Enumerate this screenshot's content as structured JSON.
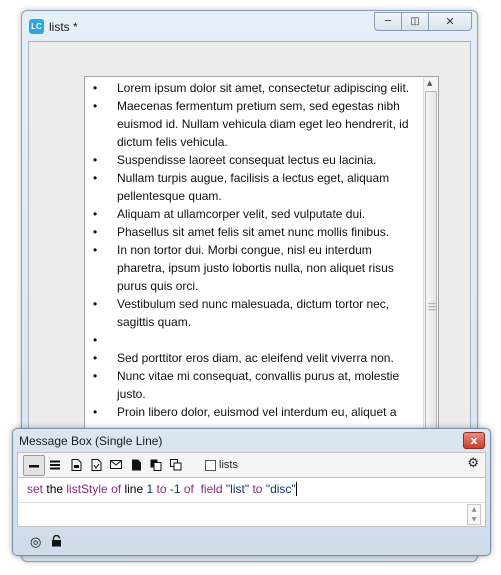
{
  "window": {
    "title": "lists *",
    "app_icon_label": "LC"
  },
  "field": {
    "items": [
      "Lorem ipsum dolor sit amet, consectetur adipiscing elit.",
      " Maecenas fermentum pretium sem, sed egestas nibh euismod id. Nullam vehicula diam eget leo hendrerit, id dictum felis vehicula.",
      "Suspendisse laoreet consequat lectus eu lacinia.",
      "Nullam turpis augue, facilisis a lectus eget, aliquam pellentesque quam.",
      "Aliquam at ullamcorper velit, sed vulputate dui.",
      "Phasellus sit amet felis sit amet nunc mollis finibus.",
      "In non tortor dui. Morbi congue, nisl eu interdum pharetra, ipsum justo lobortis nulla, non aliquet risus purus quis orci.",
      "Vestibulum sed nunc malesuada, dictum tortor nec, sagittis quam.",
      "",
      "Sed porttitor eros diam, ac eleifend velit viverra non.",
      "Nunc vitae mi consequat, convallis purus at, molestie justo.",
      "Proin libero dolor, euismod vel interdum eu, aliquet a"
    ]
  },
  "message_box": {
    "title": "Message Box (Single Line)",
    "close_glyph": "x",
    "tab_label": "lists",
    "command": {
      "set": "set",
      "the": "the",
      "listStyle": "listStyle",
      "of1": "of",
      "line": "line",
      "n1": "1",
      "to1": "to",
      "n2": "-1",
      "of2": "of",
      "field": "field",
      "field_name": "\"list\"",
      "to2": "to",
      "value": "\"disc\""
    }
  },
  "icons": {
    "single_line": "single-line-icon",
    "multi_line": "multi-line-icon",
    "global_properties": "global-properties-icon",
    "global_variables": "global-variables-icon",
    "pending_messages": "pending-messages-icon",
    "front_scripts": "front-scripts-icon",
    "back_scripts": "back-scripts-icon",
    "message_path": "message-path-icon",
    "settings": "gear-icon",
    "target": "target-icon",
    "lock": "lock-icon"
  },
  "colors": {
    "keyword": "#8a2a7a",
    "string": "#18306e",
    "close": "#c8412c",
    "accent": "#2ca8df"
  }
}
